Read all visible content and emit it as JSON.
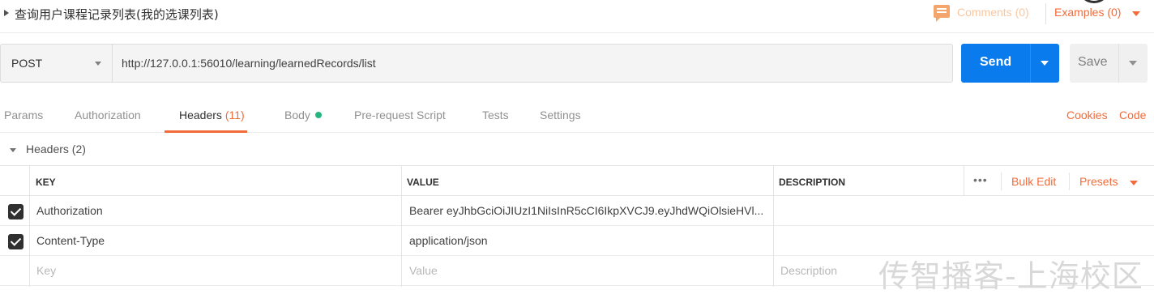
{
  "request": {
    "name": "查询用户课程记录列表(我的选课列表)",
    "comments_label": "Comments (0)",
    "examples_label": "Examples (0)",
    "method": "POST",
    "url": "http://127.0.0.1:56010/learning/learnedRecords/list",
    "send_label": "Send",
    "save_label": "Save"
  },
  "tabs": {
    "params": "Params",
    "authorization": "Authorization",
    "headers": "Headers",
    "headers_count": "(11)",
    "body": "Body",
    "pre_request": "Pre-request Script",
    "tests": "Tests",
    "settings": "Settings",
    "cookies": "Cookies",
    "code": "Code",
    "active": "headers"
  },
  "headers_section": {
    "title": "Headers (2)",
    "columns": {
      "key": "KEY",
      "value": "VALUE",
      "description": "DESCRIPTION"
    },
    "more_label": "•••",
    "bulk_edit_label": "Bulk Edit",
    "presets_label": "Presets",
    "rows": [
      {
        "checked": true,
        "key": "Authorization",
        "value": "Bearer eyJhbGciOiJIUzI1NiIsInR5cCI6IkpXVCJ9.eyJhdWQiOlsieHVl..."
      },
      {
        "checked": true,
        "key": "Content-Type",
        "value": "application/json"
      }
    ],
    "placeholders": {
      "key": "Key",
      "value": "Value",
      "description": "Description"
    }
  },
  "watermark": "传智播客-上海校区",
  "colors": {
    "accent": "#f26b3a",
    "send": "#097bed",
    "body_dot": "#26b47f"
  },
  "icons": [
    "comments-icon",
    "caret-right-icon",
    "chevron-down-icon",
    "checkbox-checked-icon"
  ]
}
